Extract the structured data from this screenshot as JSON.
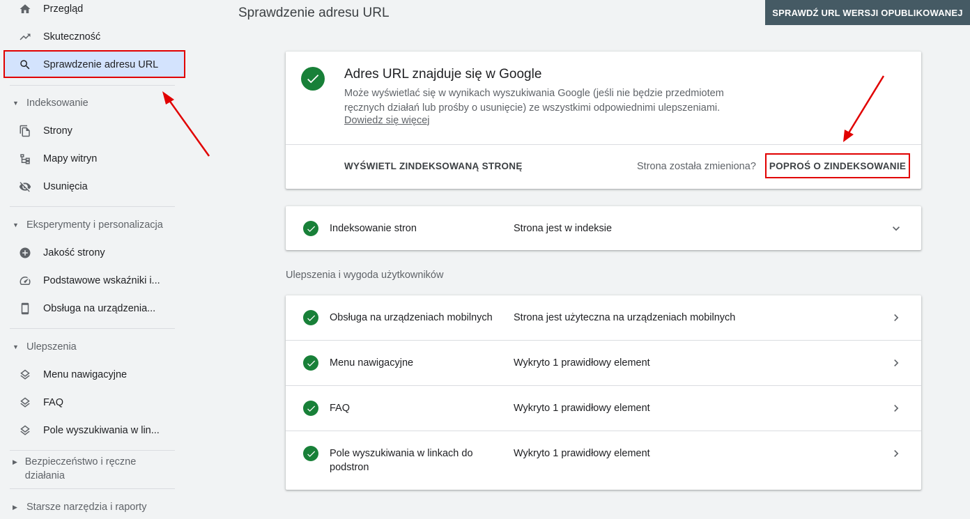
{
  "sidebar": {
    "items": [
      {
        "label": "Przegląd",
        "icon": "home-icon"
      },
      {
        "label": "Skuteczność",
        "icon": "trending-up-icon"
      },
      {
        "label": "Sprawdzenie adresu URL",
        "icon": "search-icon"
      }
    ],
    "sections": [
      {
        "title": "Indeksowanie",
        "items": [
          {
            "label": "Strony",
            "icon": "pages-icon"
          },
          {
            "label": "Mapy witryn",
            "icon": "sitemap-icon"
          },
          {
            "label": "Usunięcia",
            "icon": "visibility-off-icon"
          }
        ]
      },
      {
        "title": "Eksperymenty i personalizacja",
        "items": [
          {
            "label": "Jakość strony",
            "icon": "add-circle-icon"
          },
          {
            "label": "Podstawowe wskaźniki i...",
            "icon": "speed-icon"
          },
          {
            "label": "Obsługa na urządzenia...",
            "icon": "smartphone-icon"
          }
        ]
      },
      {
        "title": "Ulepszenia",
        "items": [
          {
            "label": "Menu nawigacyjne",
            "icon": "layers-icon"
          },
          {
            "label": "FAQ",
            "icon": "layers-icon"
          },
          {
            "label": "Pole wyszukiwania w lin...",
            "icon": "layers-icon"
          }
        ]
      },
      {
        "title": "Bezpieczeństwo i ręczne działania"
      },
      {
        "title": "Starsze narzędzia i raporty"
      }
    ]
  },
  "header": {
    "title": "Sprawdzenie adresu URL",
    "live_test_button": "SPRAWDŹ URL WERSJI OPUBLIKOWANEJ"
  },
  "status": {
    "title": "Adres URL znajduje się w Google",
    "description": "Może wyświetlać się w wynikach wyszukiwania Google (jeśli nie będzie przedmiotem ręcznych działań lub prośby o usunięcie) ze wszystkimi odpowiednimi ulepszeniami.",
    "learn_more": "Dowiedz się więcej",
    "view_indexed": "WYŚWIETL ZINDEKSOWANĄ STRONĘ",
    "changed_question": "Strona została zmieniona?",
    "request_indexing": "POPROŚ O ZINDEKSOWANIE"
  },
  "indexing": {
    "label": "Indeksowanie stron",
    "value": "Strona jest w indeksie"
  },
  "enhancements": {
    "section_title": "Ulepszenia i wygoda użytkowników",
    "rows": [
      {
        "label": "Obsługa na urządzeniach mobilnych",
        "value": "Strona jest użyteczna na urządzeniach mobilnych"
      },
      {
        "label": "Menu nawigacyjne",
        "value": "Wykryto 1 prawidłowy element"
      },
      {
        "label": "FAQ",
        "value": "Wykryto 1 prawidłowy element"
      },
      {
        "label": "Pole wyszukiwania w linkach do podstron",
        "value": "Wykryto 1 prawidłowy element"
      }
    ]
  },
  "colors": {
    "success": "#188038",
    "highlight": "#e10000",
    "active_nav": "#d3e3fd",
    "top_button": "#455a64"
  }
}
